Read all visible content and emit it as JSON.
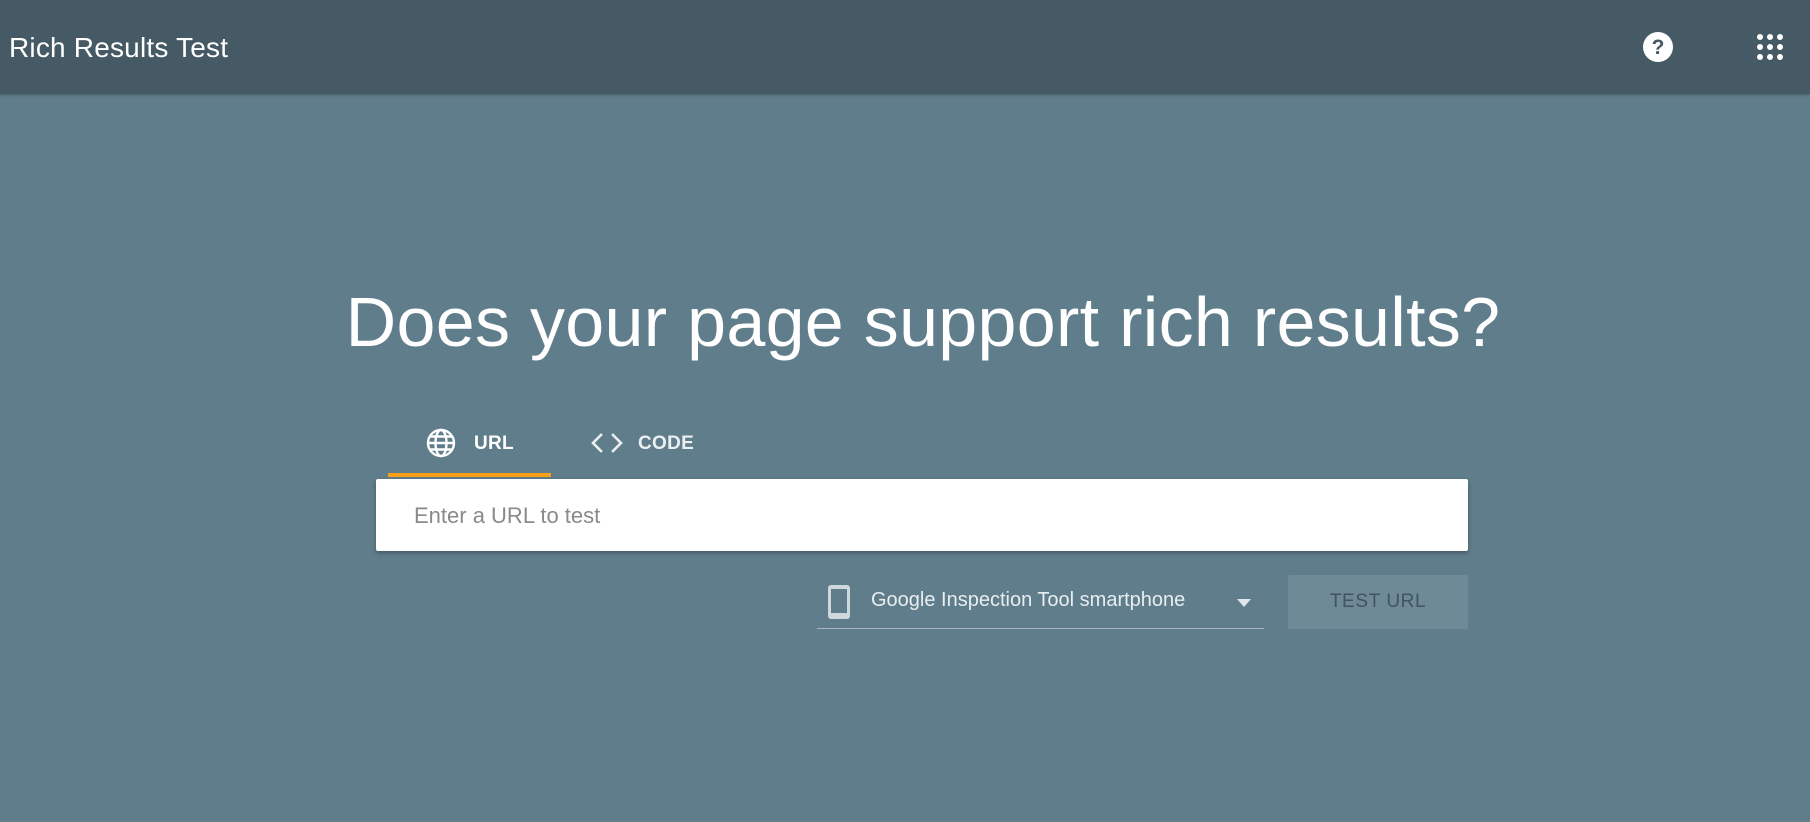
{
  "header": {
    "title": "Rich Results Test",
    "help_icon": "help-circle-icon",
    "apps_icon": "apps-grid-icon"
  },
  "main": {
    "headline": "Does your page support rich results?",
    "tabs": [
      {
        "label": "URL",
        "icon": "globe-icon",
        "selected": true
      },
      {
        "label": "CODE",
        "icon": "code-brackets-icon",
        "selected": false
      }
    ],
    "url_input": {
      "placeholder": "Enter a URL to test",
      "value": ""
    },
    "user_agent": {
      "icon": "smartphone-icon",
      "selected": "Google Inspection Tool smartphone"
    },
    "test_button": {
      "label": "TEST URL",
      "enabled": false
    }
  },
  "colors": {
    "page_background": "#607d8b",
    "header_background": "#455a64",
    "tab_indicator": "#f6a01a",
    "input_background": "#ffffff"
  }
}
